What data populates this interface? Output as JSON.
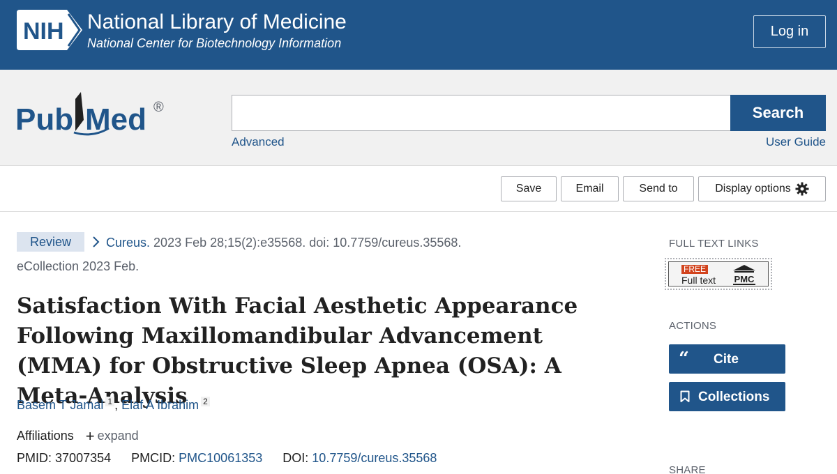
{
  "header": {
    "logo_text": "NIH",
    "title": "National Library of Medicine",
    "subtitle": "National Center for Biotechnology Information",
    "login_label": "Log in"
  },
  "search": {
    "logo_text": "PubMed",
    "logo_mark": "®",
    "value": "",
    "placeholder": "",
    "button_label": "Search",
    "advanced_label": "Advanced",
    "user_guide_label": "User Guide"
  },
  "toolbar": {
    "save_label": "Save",
    "email_label": "Email",
    "send_to_label": "Send to",
    "display_options_label": "Display options"
  },
  "article": {
    "type_badge": "Review",
    "journal": "Cureus.",
    "citation": "2023 Feb 28;15(2):e35568. doi: 10.7759/cureus.35568.",
    "ecollection": "eCollection 2023 Feb.",
    "title": "Satisfaction With Facial Aesthetic Appearance Following Maxillomandibular Advancement (MMA) for Obstructive Sleep Apnea (OSA): A Meta-Analysis",
    "authors": [
      {
        "name": "Basem T Jamal",
        "aff": "1"
      },
      {
        "name": "Elaf A Ibrahim",
        "aff": "2"
      }
    ],
    "affiliations_label": "Affiliations",
    "expand_label": "expand",
    "pmid_label": "PMID:",
    "pmid": "37007354",
    "pmcid_label": "PMCID:",
    "pmcid": "PMC10061353",
    "doi_label": "DOI:",
    "doi": "10.7759/cureus.35568"
  },
  "sidebar": {
    "full_text_heading": "FULL TEXT LINKS",
    "free_tag": "FREE",
    "full_text_label": "Full text",
    "pmc_label": "PMC",
    "actions_heading": "ACTIONS",
    "cite_label": "Cite",
    "collections_label": "Collections",
    "share_heading": "SHARE"
  },
  "colors": {
    "brand_blue": "#20558a",
    "search_band": "#f1f1f1",
    "free_tag": "#d2431d"
  }
}
